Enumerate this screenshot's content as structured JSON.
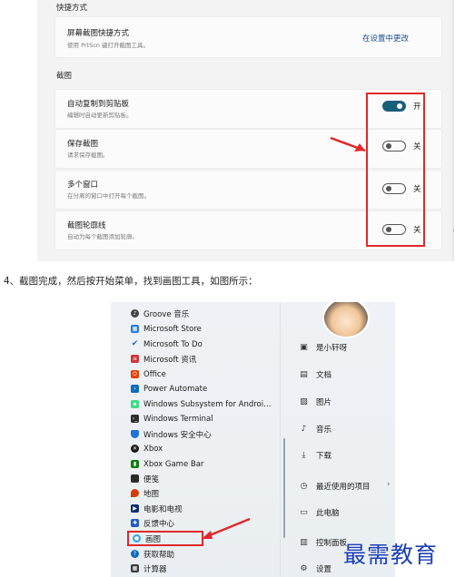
{
  "settings": {
    "section_shortcut": "快捷方式",
    "printscreen": {
      "title": "屏幕截图快捷方式",
      "desc": "使用 PrtScn 键打开截图工具。",
      "link": "在设置中更改"
    },
    "section_snip": "截图",
    "rows": [
      {
        "title": "自动复制到剪贴板",
        "desc": "编辑时自动更新剪贴板。",
        "state": "开",
        "on": true
      },
      {
        "title": "保存截图",
        "desc": "请求保存截图。",
        "state": "关",
        "on": false
      },
      {
        "title": "多个窗口",
        "desc": "在分离的窗口中打开每个截图。",
        "state": "关",
        "on": false
      },
      {
        "title": "截图轮廓线",
        "desc": "自动为每个截图添加轮廓。",
        "state": "关",
        "on": false
      }
    ],
    "accent_color": "#1a5f78",
    "highlight_color": "#e0292a"
  },
  "instruction": "4、截图完成，然后按开始菜单，找到画图工具，如图所示：",
  "start_menu": {
    "apps": [
      {
        "label": "Groove 音乐",
        "icon": "groove-music-icon"
      },
      {
        "label": "Microsoft Store",
        "icon": "store-icon"
      },
      {
        "label": "Microsoft To Do",
        "icon": "todo-icon"
      },
      {
        "label": "Microsoft 资讯",
        "icon": "news-icon"
      },
      {
        "label": "Office",
        "icon": "office-icon"
      },
      {
        "label": "Power Automate",
        "icon": "power-automate-icon"
      },
      {
        "label": "Windows Subsystem for Androi…",
        "icon": "wsa-icon"
      },
      {
        "label": "Windows Terminal",
        "icon": "terminal-icon"
      },
      {
        "label": "Windows 安全中心",
        "icon": "security-icon"
      },
      {
        "label": "Xbox",
        "icon": "xbox-icon"
      },
      {
        "label": "Xbox Game Bar",
        "icon": "xbox-game-bar-icon"
      },
      {
        "label": "便笺",
        "icon": "sticky-notes-icon"
      },
      {
        "label": "地图",
        "icon": "maps-icon"
      },
      {
        "label": "电影和电视",
        "icon": "movies-icon"
      },
      {
        "label": "反馈中心",
        "icon": "feedback-icon"
      },
      {
        "label": "画图",
        "icon": "paint-icon"
      },
      {
        "label": "获取帮助",
        "icon": "help-icon"
      },
      {
        "label": "计算器",
        "icon": "calculator-icon"
      }
    ],
    "side": [
      {
        "label": "是小轩呀",
        "icon": "user-folder-icon"
      },
      {
        "label": "文档",
        "icon": "document-icon"
      },
      {
        "label": "图片",
        "icon": "pictures-icon"
      },
      {
        "label": "音乐",
        "icon": "music-icon"
      },
      {
        "label": "下载",
        "icon": "download-icon"
      },
      {
        "label": "最近使用的项目",
        "icon": "recent-icon"
      },
      {
        "label": "此电脑",
        "icon": "pc-icon"
      },
      {
        "label": "控制面板",
        "icon": "control-panel-icon"
      },
      {
        "label": "设置",
        "icon": "settings-icon"
      }
    ]
  },
  "watermark": "最需教育"
}
